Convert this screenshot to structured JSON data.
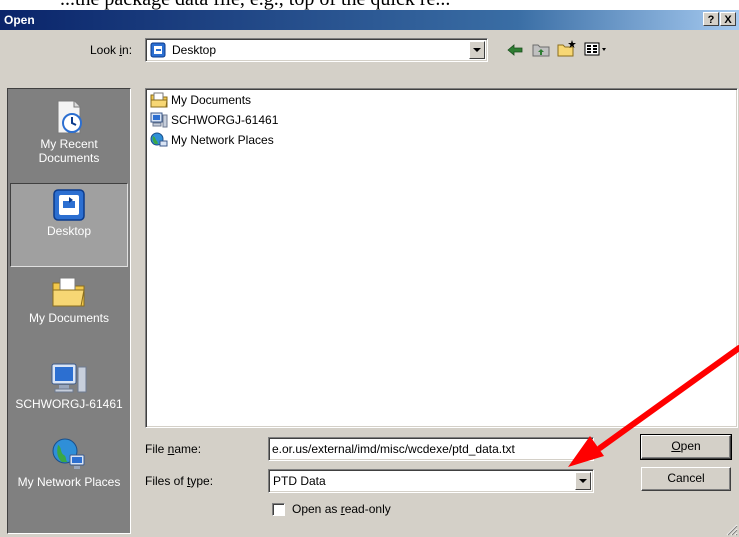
{
  "caption": "...the package data file, e.g., top of the quick re...",
  "window": {
    "title": "Open",
    "help_label": "?",
    "close_label": "X"
  },
  "look_in": {
    "label_pre": "Look ",
    "label_accel": "i",
    "label_post": "n:",
    "value": "Desktop"
  },
  "toolbar": {
    "back_icon": "back-arrow-icon",
    "up_icon": "up-folder-icon",
    "new_folder_icon": "new-folder-icon",
    "views_icon": "views-menu-icon"
  },
  "places": [
    {
      "label": "My Recent Documents",
      "icon": "recent-documents-icon"
    },
    {
      "label": "Desktop",
      "icon": "desktop-icon",
      "selected": true
    },
    {
      "label": "My Documents",
      "icon": "my-documents-icon"
    },
    {
      "label": "SCHWORGJ-61461",
      "icon": "computer-icon"
    },
    {
      "label": "My Network Places",
      "icon": "network-places-icon"
    }
  ],
  "files": [
    {
      "name": "My Documents",
      "icon": "folder-documents-icon"
    },
    {
      "name": "SCHWORGJ-61461",
      "icon": "computer-icon"
    },
    {
      "name": "My Network Places",
      "icon": "network-places-icon"
    }
  ],
  "file_name": {
    "label_pre": "File ",
    "label_accel": "n",
    "label_post": "ame:",
    "value": "e.or.us/external/imd/misc/wcdexe/ptd_data.txt"
  },
  "files_of_type": {
    "label_pre": "Files of ",
    "label_accel": "t",
    "label_post": "ype:",
    "value": "PTD Data"
  },
  "buttons": {
    "open_accel": "O",
    "open_rest": "pen",
    "cancel": "Cancel"
  },
  "read_only": {
    "label_pre": "Open as ",
    "label_accel": "r",
    "label_post": "ead-only",
    "checked": false
  },
  "colors": {
    "annotation_arrow": "#ff0000",
    "title_bar": "#0a246a",
    "dialog_face": "#d4d0c8",
    "places_bar": "#808080"
  }
}
